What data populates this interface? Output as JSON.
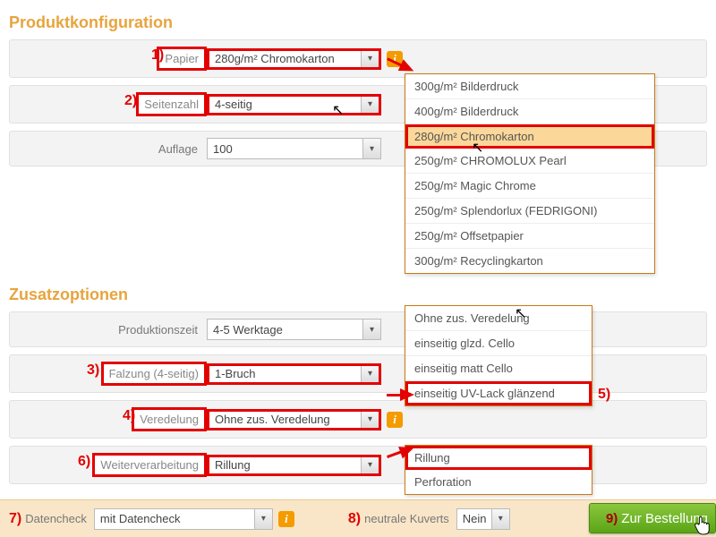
{
  "section1_title": "Produktkonfiguration",
  "section2_title": "Zusatzoptionen",
  "markers": {
    "m1": "1)",
    "m2": "2)",
    "m3": "3)",
    "m4": "4)",
    "m5": "5)",
    "m6": "6)",
    "m7": "7)",
    "m8": "8)",
    "m9": "9)"
  },
  "rows": {
    "papier": {
      "label": "Papier",
      "value": "280g/m² Chromokarton"
    },
    "seitenzahl": {
      "label": "Seitenzahl",
      "value": "4-seitig"
    },
    "auflage": {
      "label": "Auflage",
      "value": "100"
    },
    "produktionszeit": {
      "label": "Produktionszeit",
      "value": "4-5 Werktage"
    },
    "falzung": {
      "label": "Falzung (4-seitig)",
      "value": "1-Bruch"
    },
    "veredelung": {
      "label": "Veredelung",
      "value": "Ohne zus. Veredelung"
    },
    "weiterverarbeitung": {
      "label": "Weiterverarbeitung",
      "value": "Rillung"
    }
  },
  "papier_options": [
    "300g/m² Bilderdruck",
    "400g/m² Bilderdruck",
    "280g/m² Chromokarton",
    "250g/m² CHROMOLUX Pearl",
    "250g/m² Magic Chrome",
    "250g/m² Splendorlux (FEDRIGONI)",
    "250g/m² Offsetpapier",
    "300g/m² Recyclingkarton"
  ],
  "veredelung_options": [
    "Ohne zus. Veredelung",
    "einseitig glzd. Cello",
    "einseitig matt Cello",
    "einseitig UV-Lack glänzend"
  ],
  "weiter_options": [
    "Rillung",
    "Perforation"
  ],
  "bottom": {
    "datencheck_label": "Datencheck",
    "datencheck_value": "mit Datencheck",
    "kuverts_label": "neutrale Kuverts",
    "kuverts_value": "Nein",
    "order_btn": "Zur Bestellung"
  },
  "info_glyph": "i"
}
